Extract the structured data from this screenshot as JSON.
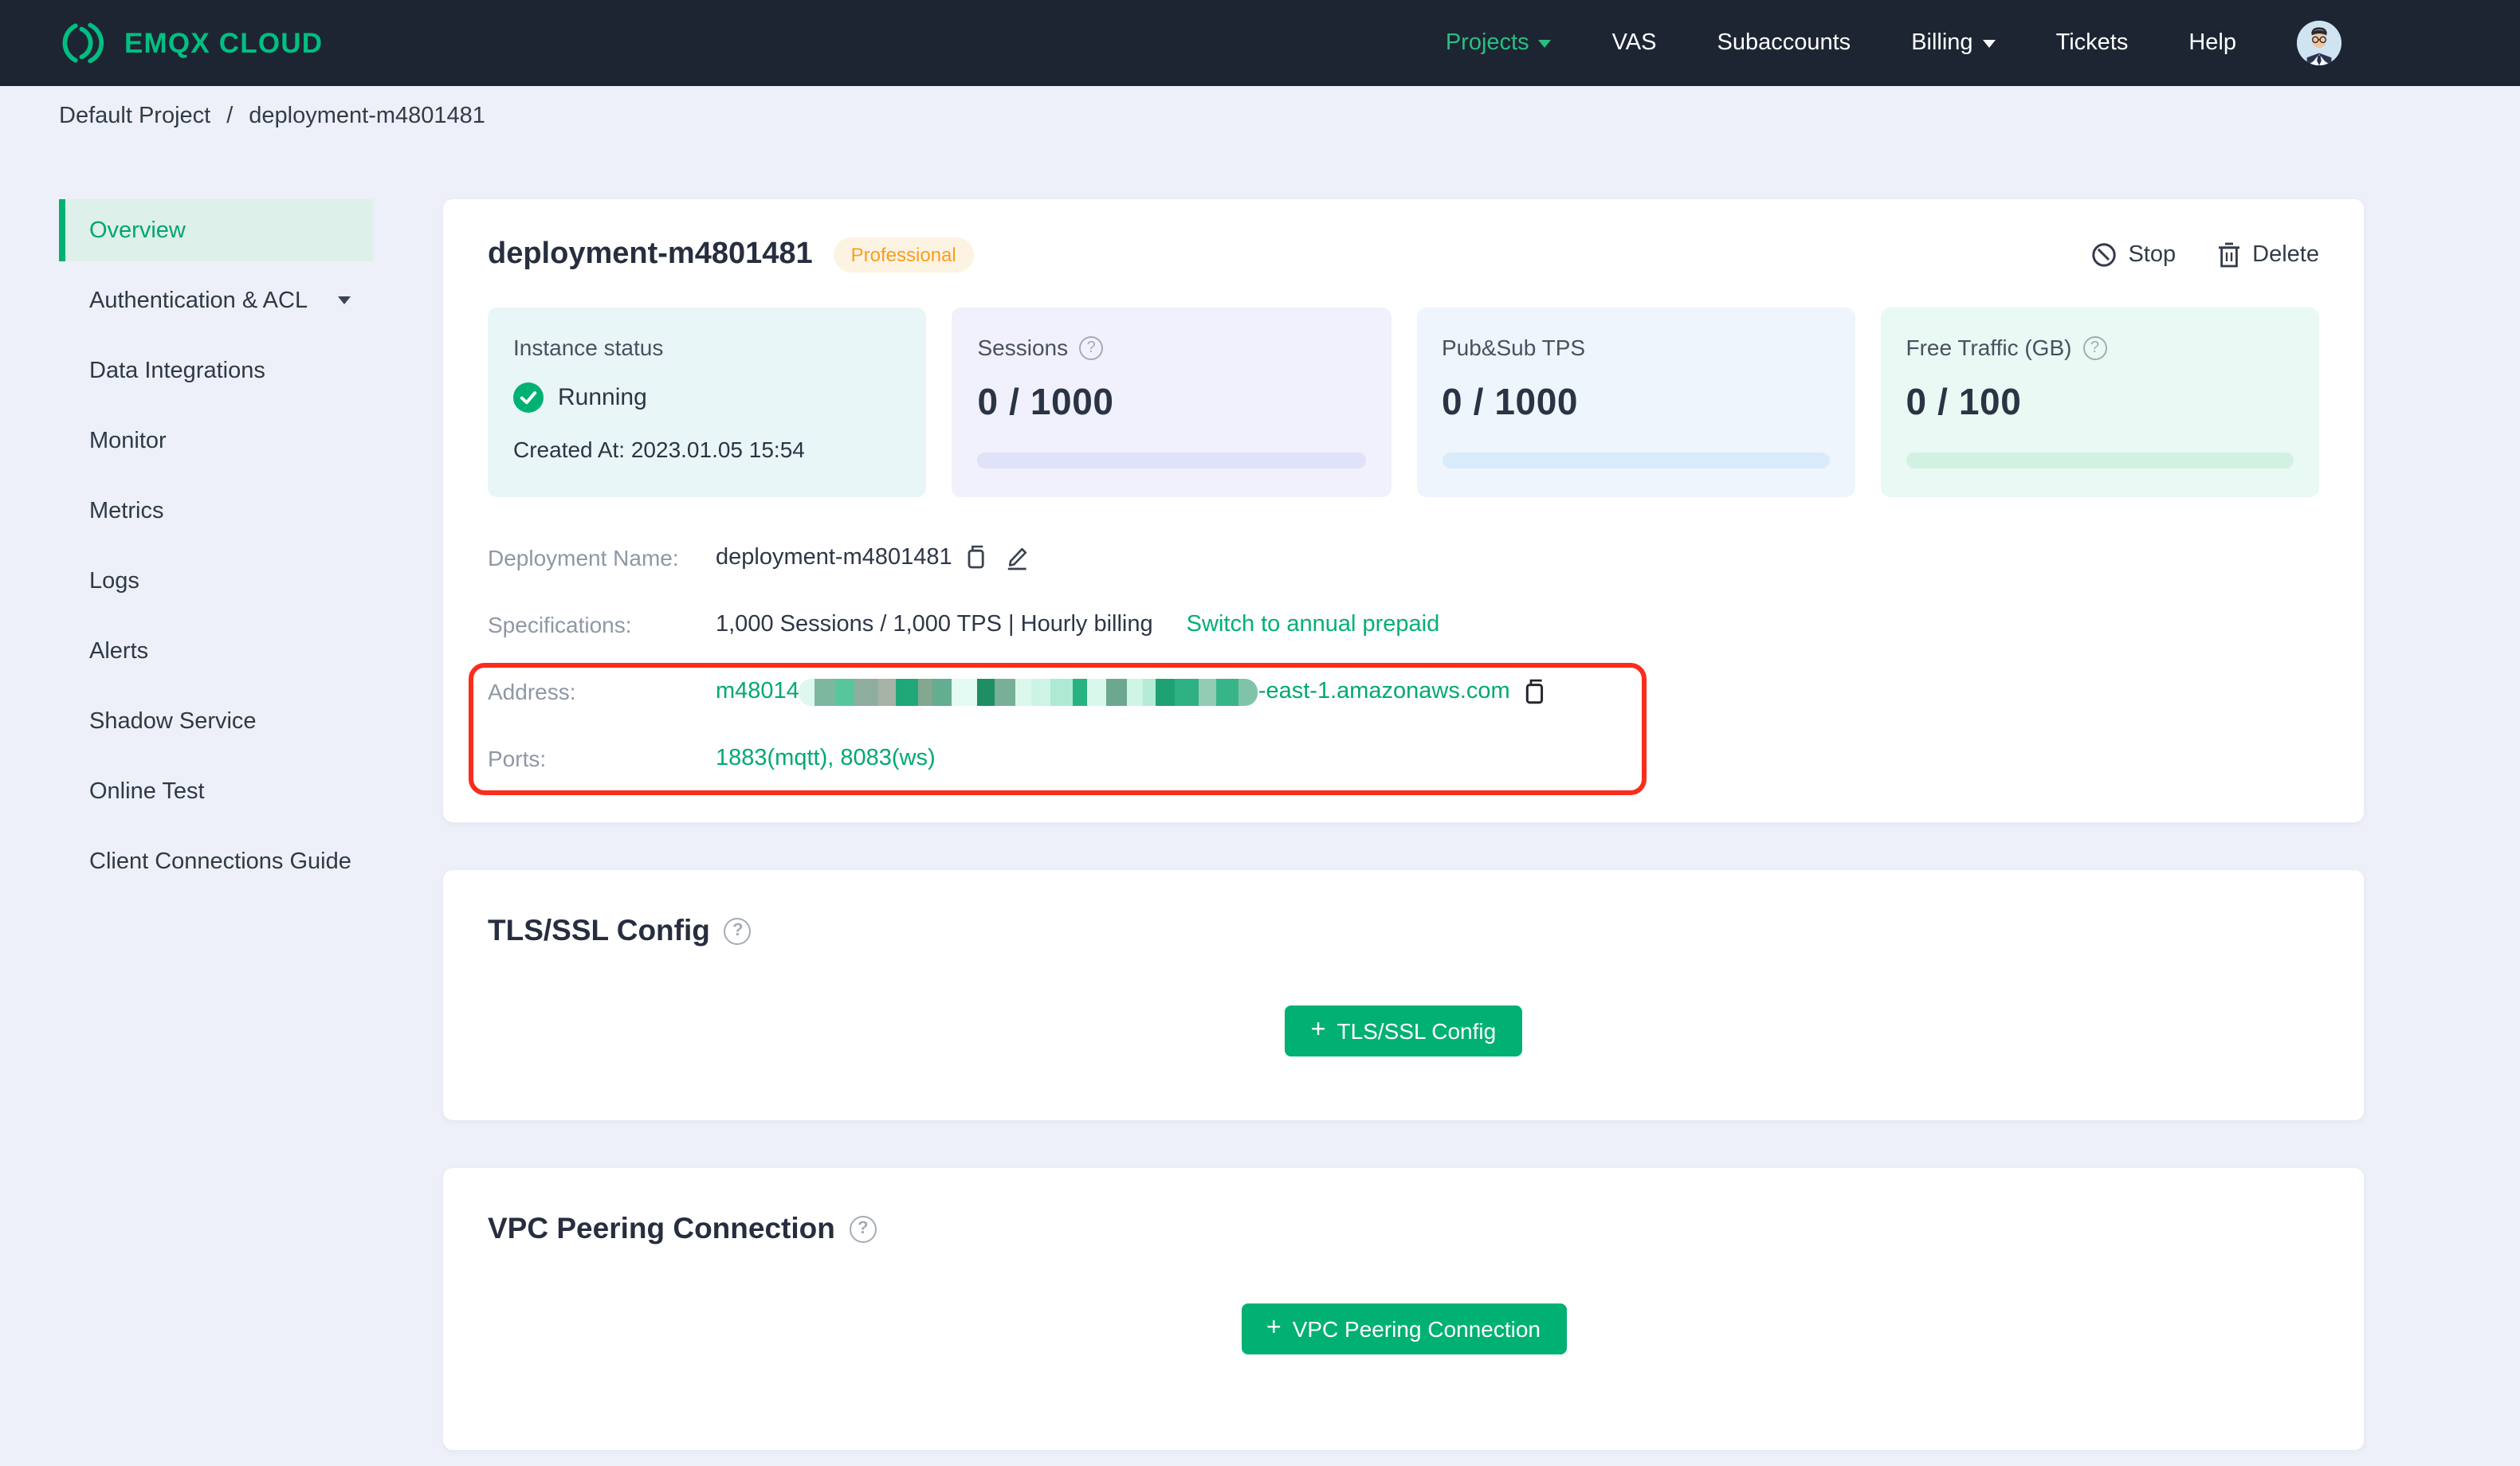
{
  "navbar": {
    "logo_text": "EMQX CLOUD",
    "items": [
      {
        "label": "Projects"
      },
      {
        "label": "VAS"
      },
      {
        "label": "Subaccounts"
      },
      {
        "label": "Billing"
      },
      {
        "label": "Tickets"
      },
      {
        "label": "Help"
      }
    ]
  },
  "breadcrumb": {
    "project": "Default Project",
    "separator": "/",
    "current": "deployment-m4801481"
  },
  "sidebar": {
    "items": [
      {
        "label": "Overview"
      },
      {
        "label": "Authentication & ACL"
      },
      {
        "label": "Data Integrations"
      },
      {
        "label": "Monitor"
      },
      {
        "label": "Metrics"
      },
      {
        "label": "Logs"
      },
      {
        "label": "Alerts"
      },
      {
        "label": "Shadow Service"
      },
      {
        "label": "Online Test"
      },
      {
        "label": "Client Connections Guide"
      }
    ]
  },
  "deployment": {
    "name": "deployment-m4801481",
    "plan_badge": "Professional",
    "stop_label": "Stop",
    "delete_label": "Delete"
  },
  "stats": {
    "cards": [
      {
        "label": "Instance status",
        "status": "Running",
        "created_at": "Created At: 2023.01.05 15:54",
        "bg": "#e9f6f8"
      },
      {
        "label": "Sessions",
        "value": "0 / 1000",
        "bg": "#f0f1fc",
        "track": "#dfe2f9"
      },
      {
        "label": "Pub&Sub TPS",
        "value": "0 / 1000",
        "bg": "#eef5fd",
        "track": "#d9ebfa"
      },
      {
        "label": "Free Traffic (GB)",
        "value": "0 / 100",
        "bg": "#e9f9f3",
        "track": "#d3f1e2"
      }
    ]
  },
  "details": {
    "deployment_name": {
      "label": "Deployment Name:",
      "value": "deployment-m4801481"
    },
    "specifications": {
      "label": "Specifications:",
      "value": "1,000 Sessions / 1,000 TPS | Hourly billing",
      "link": "Switch to annual prepaid"
    },
    "address": {
      "label": "Address:",
      "prefix": "m48014",
      "suffix": "-east-1.amazonaws.com",
      "redaction_colors": [
        "#dff8ef",
        "#7db89e",
        "#57c79b",
        "#8fae9f",
        "#a8b3a8",
        "#21a878",
        "#84a78f",
        "#63ad90",
        "#e3fbf3",
        "#1d8f63",
        "#78b097",
        "#dcf8ed",
        "#cdf4e5",
        "#aeead3",
        "#27b381",
        "#d8f8ec",
        "#6ba88f",
        "#cff5e7",
        "#b4ecd6",
        "#1ea273",
        "#2fb283",
        "#93ccb4",
        "#38b588",
        "#7fc3a8"
      ],
      "redaction_widths": [
        10,
        13,
        12,
        15,
        11,
        14,
        9,
        12,
        16,
        11,
        13,
        10,
        12,
        14,
        9,
        12,
        13,
        10,
        8,
        12,
        15,
        11,
        14,
        12
      ]
    },
    "ports": {
      "label": "Ports:",
      "value": "1883(mqtt), 8083(ws)"
    }
  },
  "sections": {
    "tls": {
      "title": "TLS/SSL Config",
      "button": "TLS/SSL Config"
    },
    "vpc": {
      "title": "VPC Peering Connection",
      "button": "VPC Peering Connection"
    }
  },
  "colors": {
    "brand_green": "#00b173",
    "logo_green": "#00c081",
    "annotation_red": "#fa2c1c",
    "navbar_bg": "#1d2533",
    "page_bg": "#edf0f8",
    "badge_text": "#f99d1c",
    "badge_bg": "#fdf3e3",
    "active_item_bg": "#ddf0e9"
  }
}
